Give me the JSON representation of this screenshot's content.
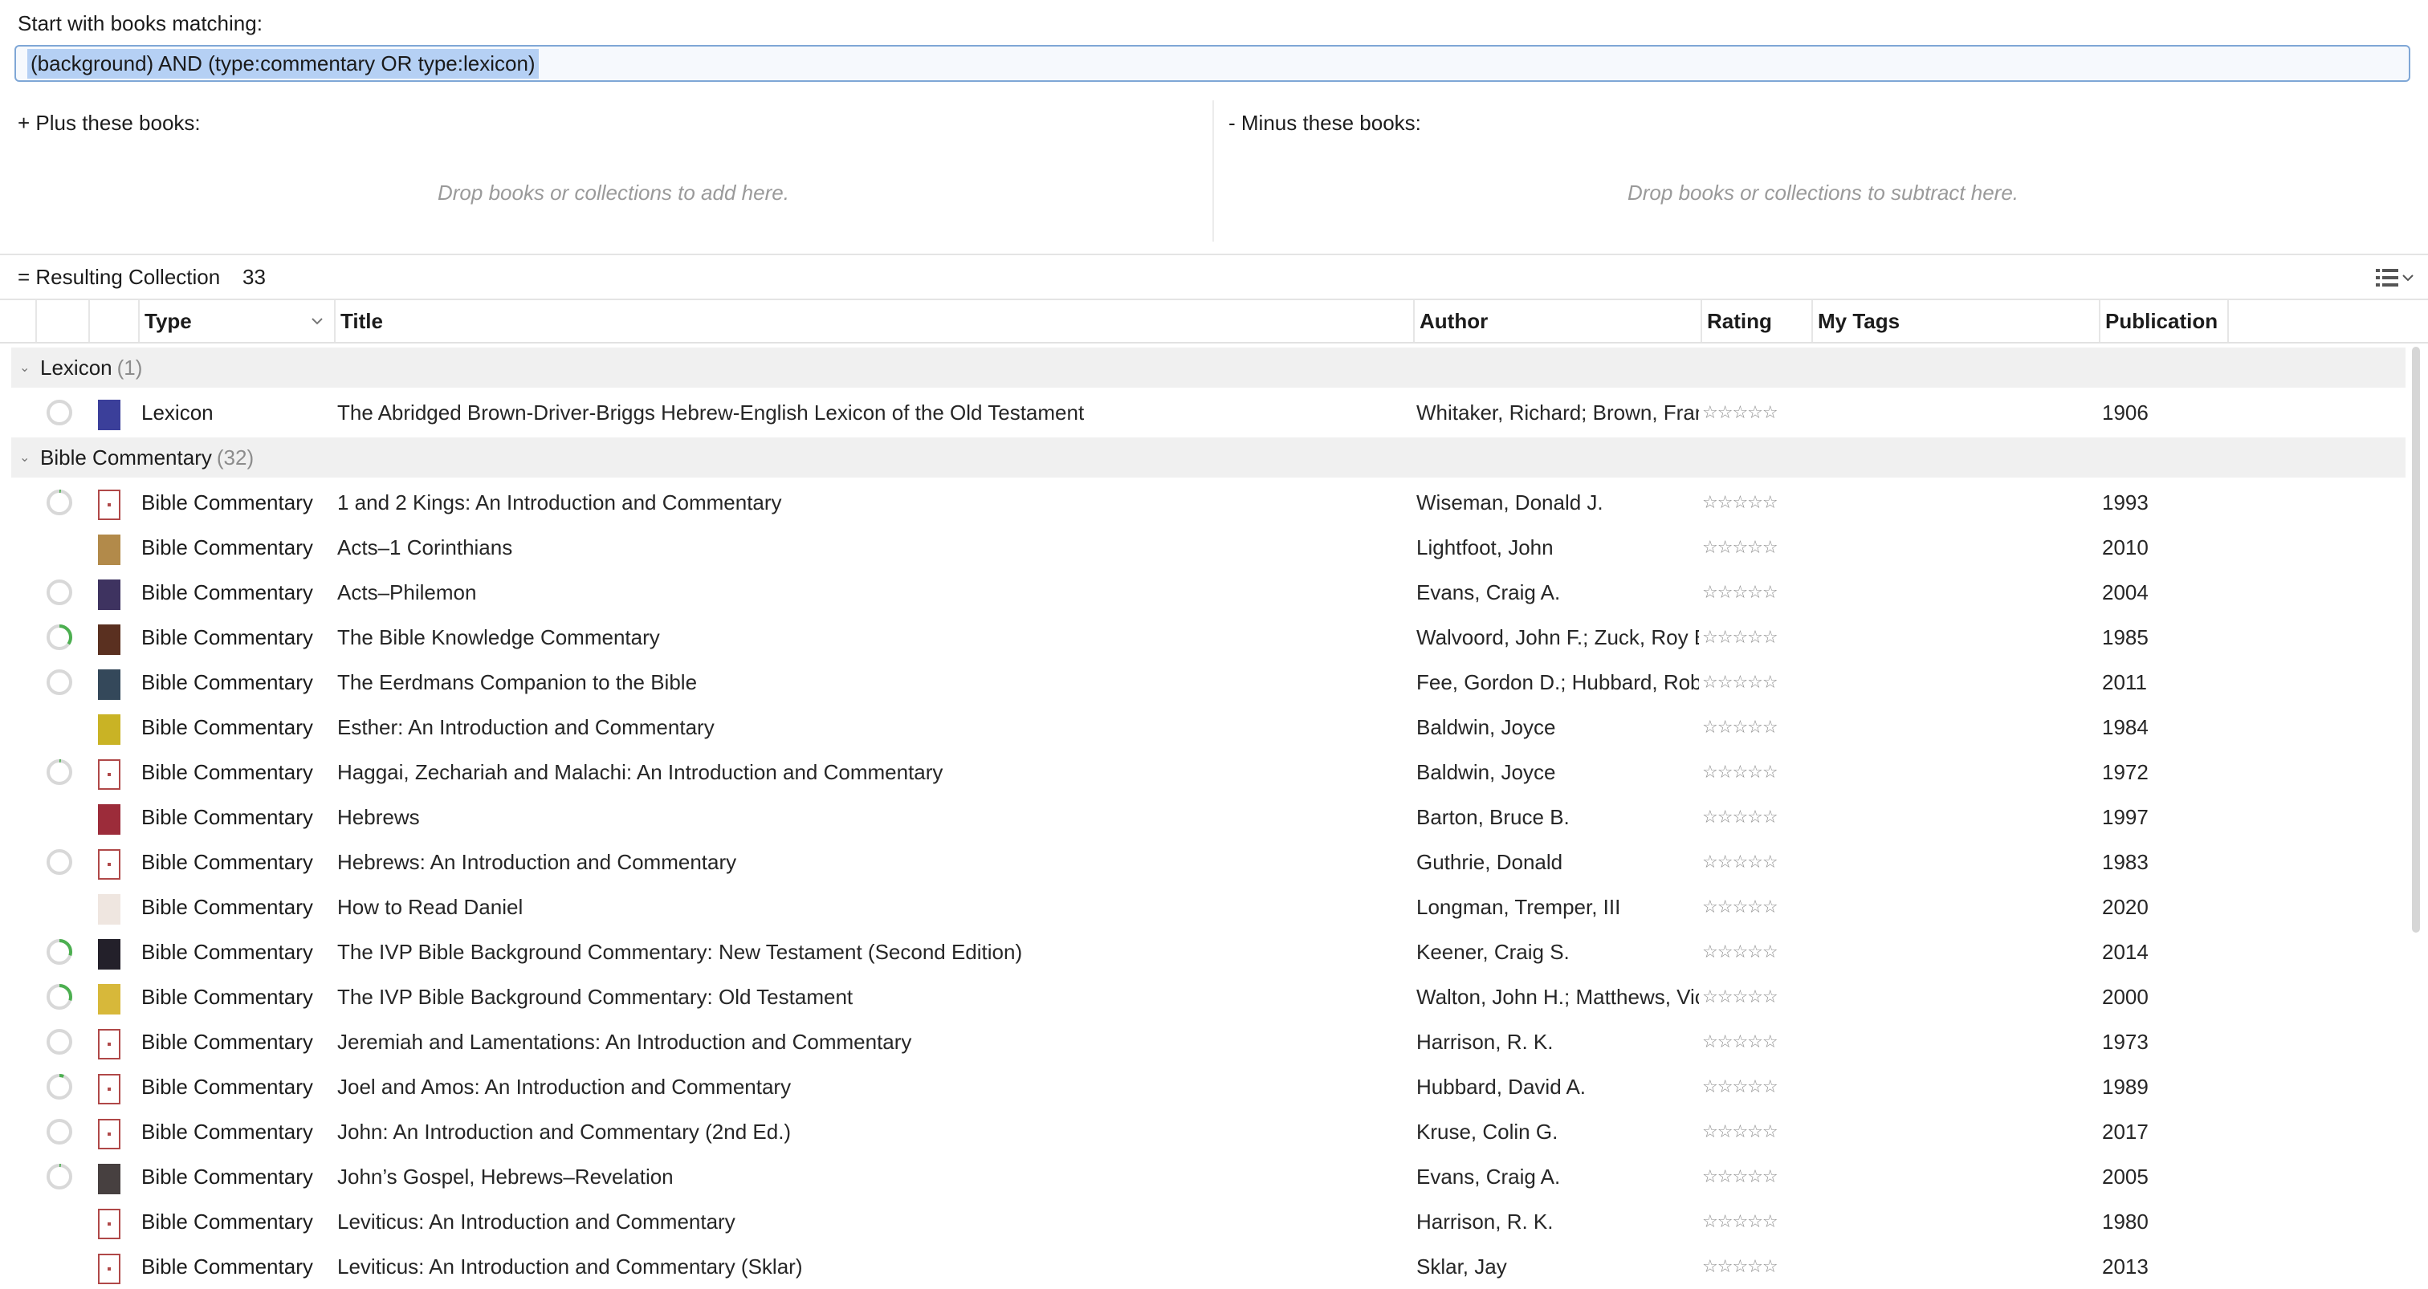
{
  "filter": {
    "start_label": "Start with  books matching:",
    "query": "(background) AND (type:commentary OR type:lexicon)",
    "plus_label": "+ Plus these books:",
    "minus_label": "-  Minus these books:",
    "plus_hint": "Drop books or collections to add here.",
    "minus_hint": "Drop books or collections to subtract here."
  },
  "result": {
    "label": "= Resulting Collection",
    "count": "33"
  },
  "columns": {
    "type": "Type",
    "title": "Title",
    "author": "Author",
    "rating": "Rating",
    "my_tags": "My Tags",
    "publication": "Publication"
  },
  "groups": [
    {
      "name": "Lexicon",
      "count": "(1)"
    },
    {
      "name": "Bible Commentary",
      "count": "(32)"
    }
  ],
  "rating_stars": "☆☆☆☆☆",
  "rows": [
    {
      "type": "Lexicon",
      "title": "The Abridged Brown-Driver-Briggs Hebrew-English Lexicon of the Old Testament",
      "author": "Whitaker, Richard; Brown, Fran",
      "pub": "1906",
      "progress": 0.0,
      "cover": "#3b3f9a"
    },
    {
      "type": "Bible Commentary",
      "title": "1 and 2 Kings: An Introduction and Commentary",
      "author": "Wiseman, Donald J.",
      "pub": "1993",
      "progress": 0.02,
      "cover": "plain"
    },
    {
      "type": "Bible Commentary",
      "title": "Acts–1 Corinthians",
      "author": "Lightfoot, John",
      "pub": "2010",
      "progress": null,
      "cover": "#b28a4a"
    },
    {
      "type": "Bible Commentary",
      "title": "Acts–Philemon",
      "author": "Evans, Craig A.",
      "pub": "2004",
      "progress": 0.0,
      "cover": "#3e3360"
    },
    {
      "type": "Bible Commentary",
      "title": "The Bible Knowledge Commentary",
      "author": "Walvoord, John F.; Zuck, Roy B",
      "pub": "1985",
      "progress": 0.35,
      "cover": "#5a3020"
    },
    {
      "type": "Bible Commentary",
      "title": "The Eerdmans Companion to the Bible",
      "author": "Fee, Gordon D.; Hubbard, Robe",
      "pub": "2011",
      "progress": 0.0,
      "cover": "#34485a"
    },
    {
      "type": "Bible Commentary",
      "title": "Esther: An Introduction and Commentary",
      "author": "Baldwin, Joyce",
      "pub": "1984",
      "progress": null,
      "cover": "#c9b325"
    },
    {
      "type": "Bible Commentary",
      "title": "Haggai, Zechariah and Malachi: An Introduction and Commentary",
      "author": "Baldwin, Joyce",
      "pub": "1972",
      "progress": 0.02,
      "cover": "plain"
    },
    {
      "type": "Bible Commentary",
      "title": "Hebrews",
      "author": "Barton, Bruce B.",
      "pub": "1997",
      "progress": null,
      "cover": "#9c2c3a"
    },
    {
      "type": "Bible Commentary",
      "title": "Hebrews: An Introduction and Commentary",
      "author": "Guthrie, Donald",
      "pub": "1983",
      "progress": 0.0,
      "cover": "plain"
    },
    {
      "type": "Bible Commentary",
      "title": "How to Read Daniel",
      "author": "Longman, Tremper, III",
      "pub": "2020",
      "progress": null,
      "cover": "#efe6e0"
    },
    {
      "type": "Bible Commentary",
      "title": "The IVP Bible Background Commentary: New Testament (Second Edition)",
      "author": "Keener, Craig S.",
      "pub": "2014",
      "progress": 0.3,
      "cover": "#23202a"
    },
    {
      "type": "Bible Commentary",
      "title": "The IVP Bible Background Commentary: Old Testament",
      "author": "Walton, John H.; Matthews, Vic",
      "pub": "2000",
      "progress": 0.3,
      "cover": "#d7b83a"
    },
    {
      "type": "Bible Commentary",
      "title": "Jeremiah and Lamentations: An Introduction and Commentary",
      "author": "Harrison, R. K.",
      "pub": "1973",
      "progress": 0.0,
      "cover": "plain"
    },
    {
      "type": "Bible Commentary",
      "title": "Joel and Amos: An Introduction and Commentary",
      "author": "Hubbard, David A.",
      "pub": "1989",
      "progress": 0.06,
      "cover": "plain"
    },
    {
      "type": "Bible Commentary",
      "title": "John: An Introduction and Commentary (2nd Ed.)",
      "author": "Kruse, Colin G.",
      "pub": "2017",
      "progress": 0.0,
      "cover": "plain"
    },
    {
      "type": "Bible Commentary",
      "title": "John’s Gospel, Hebrews–Revelation",
      "author": "Evans, Craig A.",
      "pub": "2005",
      "progress": 0.02,
      "cover": "#474040"
    },
    {
      "type": "Bible Commentary",
      "title": "Leviticus: An Introduction and Commentary",
      "author": "Harrison, R. K.",
      "pub": "1980",
      "progress": null,
      "cover": "plain"
    },
    {
      "type": "Bible Commentary",
      "title": "Leviticus: An Introduction and Commentary (Sklar)",
      "author": "Sklar, Jay",
      "pub": "2013",
      "progress": null,
      "cover": "plain"
    }
  ]
}
